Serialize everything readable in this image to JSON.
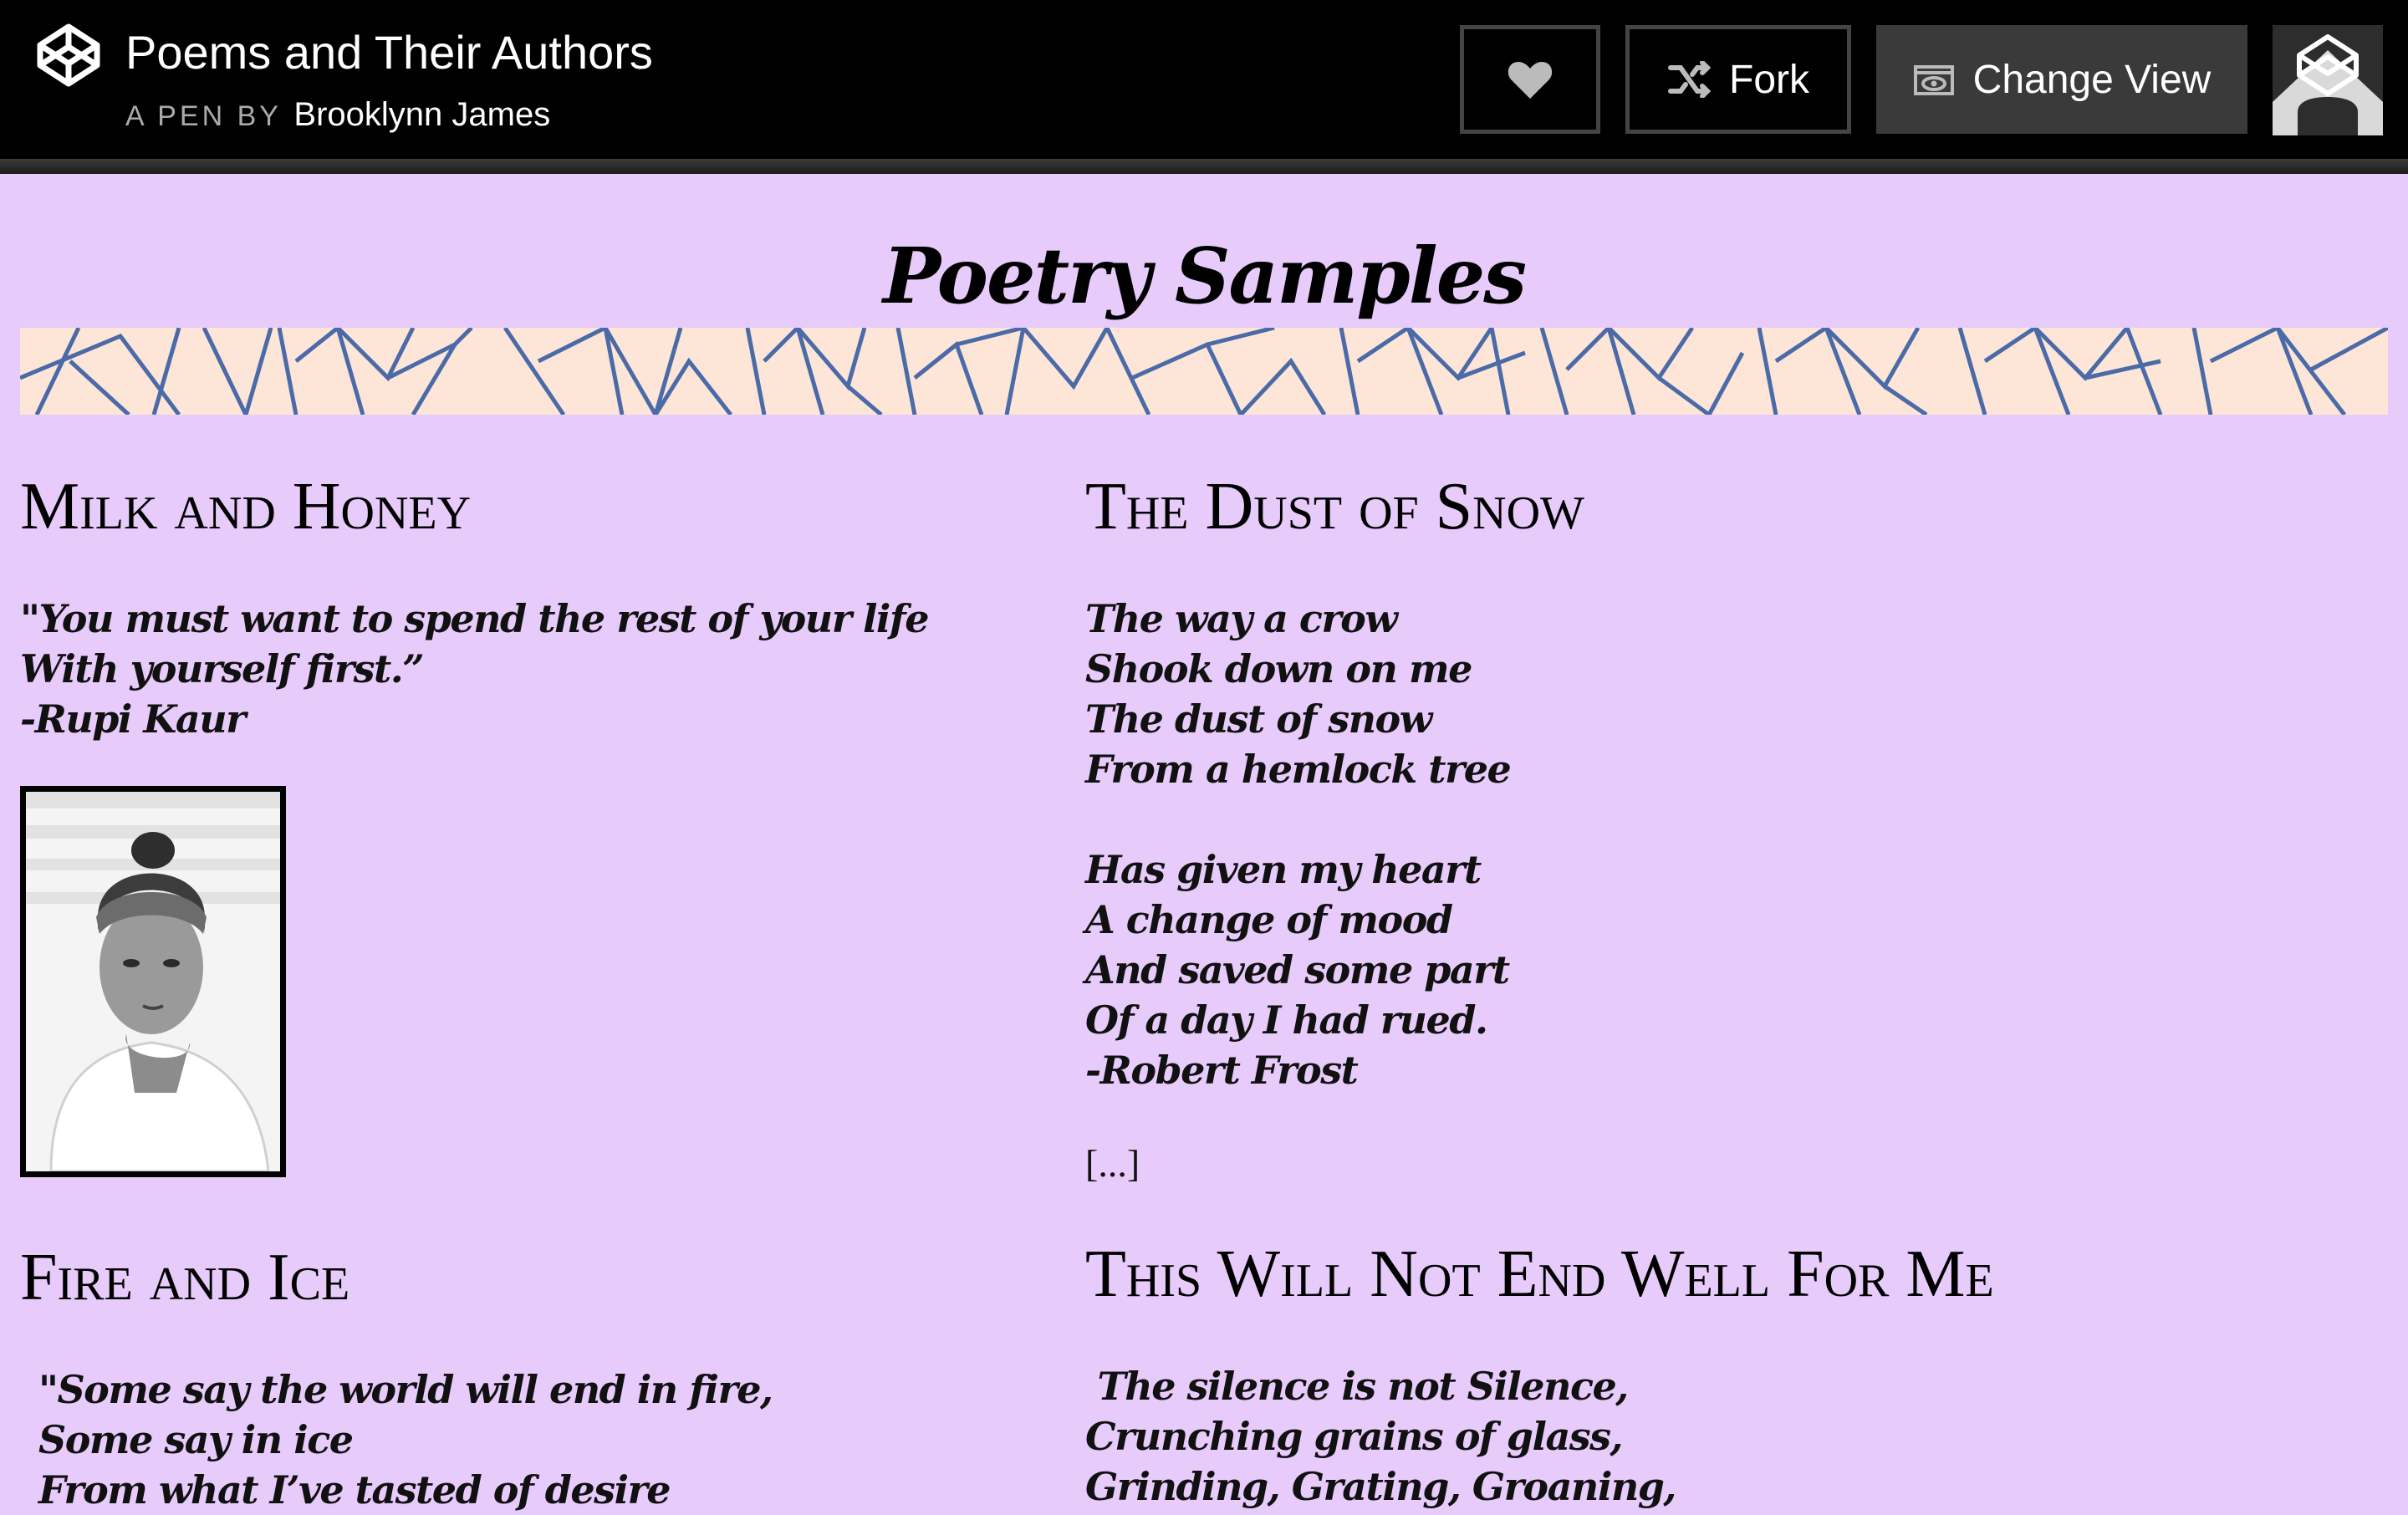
{
  "header": {
    "pen_title": "Poems and Their Authors",
    "byline_label": "A PEN BY",
    "author": "Brooklynn James",
    "fork_label": "Fork",
    "change_view_label": "Change View",
    "icons": [
      "codepen-logo-icon",
      "heart-icon",
      "fork-icon",
      "eye-icon",
      "user-avatar"
    ]
  },
  "page": {
    "heading": "Poetry Samples",
    "colors": {
      "background": "#e7cbfb",
      "banner": "#fde5d7",
      "banner_lines": "#4a6aa8"
    }
  },
  "poems": [
    {
      "title": "Milk and Honey",
      "lines": [
        "\"You must want to spend the rest of your life",
        "With yourself first.”",
        "-Rupi Kaur"
      ]
    },
    {
      "title": "The Dust of Snow",
      "lines": [
        "The way a crow",
        "Shook down on me",
        "The dust of snow",
        "From a hemlock tree",
        "",
        "Has given my heart",
        "A change of mood",
        "And saved some part",
        "Of a day I had rued.",
        "-Robert Frost"
      ],
      "more_link": "[...]"
    },
    {
      "title": "Fire and Ice",
      "lines": [
        "\"Some say the world will end in fire,",
        "Some say in ice",
        "From what I’ve tasted of desire"
      ]
    },
    {
      "title": "This Will Not End Well For Me",
      "lines": [
        " The silence is not Silence,",
        "Crunching grains of glass,",
        "Grinding, Grating, Groaning,"
      ]
    }
  ]
}
